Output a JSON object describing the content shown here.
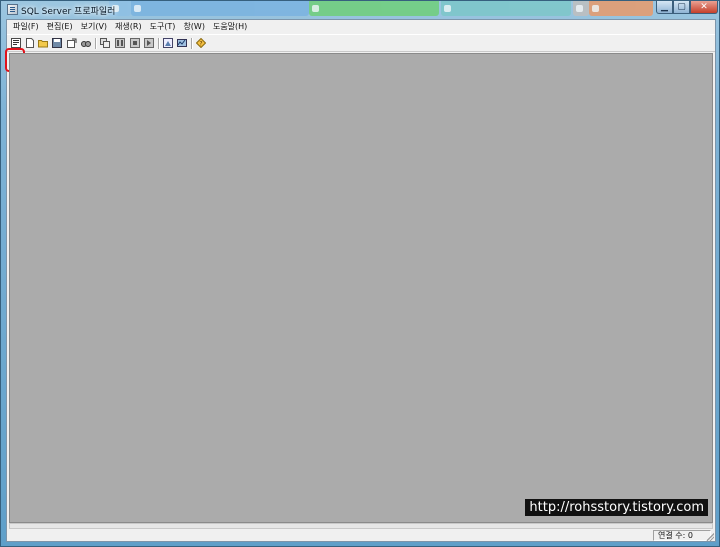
{
  "window": {
    "title": "SQL Server 프로파일러",
    "background_tabs": [
      "",
      "",
      "",
      "",
      "",
      ""
    ]
  },
  "menu": [
    {
      "label": "파일(F)"
    },
    {
      "label": "편집(E)"
    },
    {
      "label": "보기(V)"
    },
    {
      "label": "재생(R)"
    },
    {
      "label": "도구(T)"
    },
    {
      "label": "창(W)"
    },
    {
      "label": "도움말(H)"
    }
  ],
  "toolbar": {
    "icons": [
      "new-trace-icon",
      "new-document-icon",
      "open-folder-icon",
      "save-icon",
      "properties-icon",
      "find-icon",
      "play-trace-icon",
      "pause-trace-icon",
      "stop-trace-icon",
      "step-icon",
      "database-tuning-icon",
      "performance-monitor-icon",
      "help-icon"
    ]
  },
  "watermark": "http://rohsstory.tistory.com",
  "status": {
    "connections_label": "연결 수: 0"
  },
  "colors": {
    "workspace": "#ababab",
    "highlight": "#e0121b"
  }
}
